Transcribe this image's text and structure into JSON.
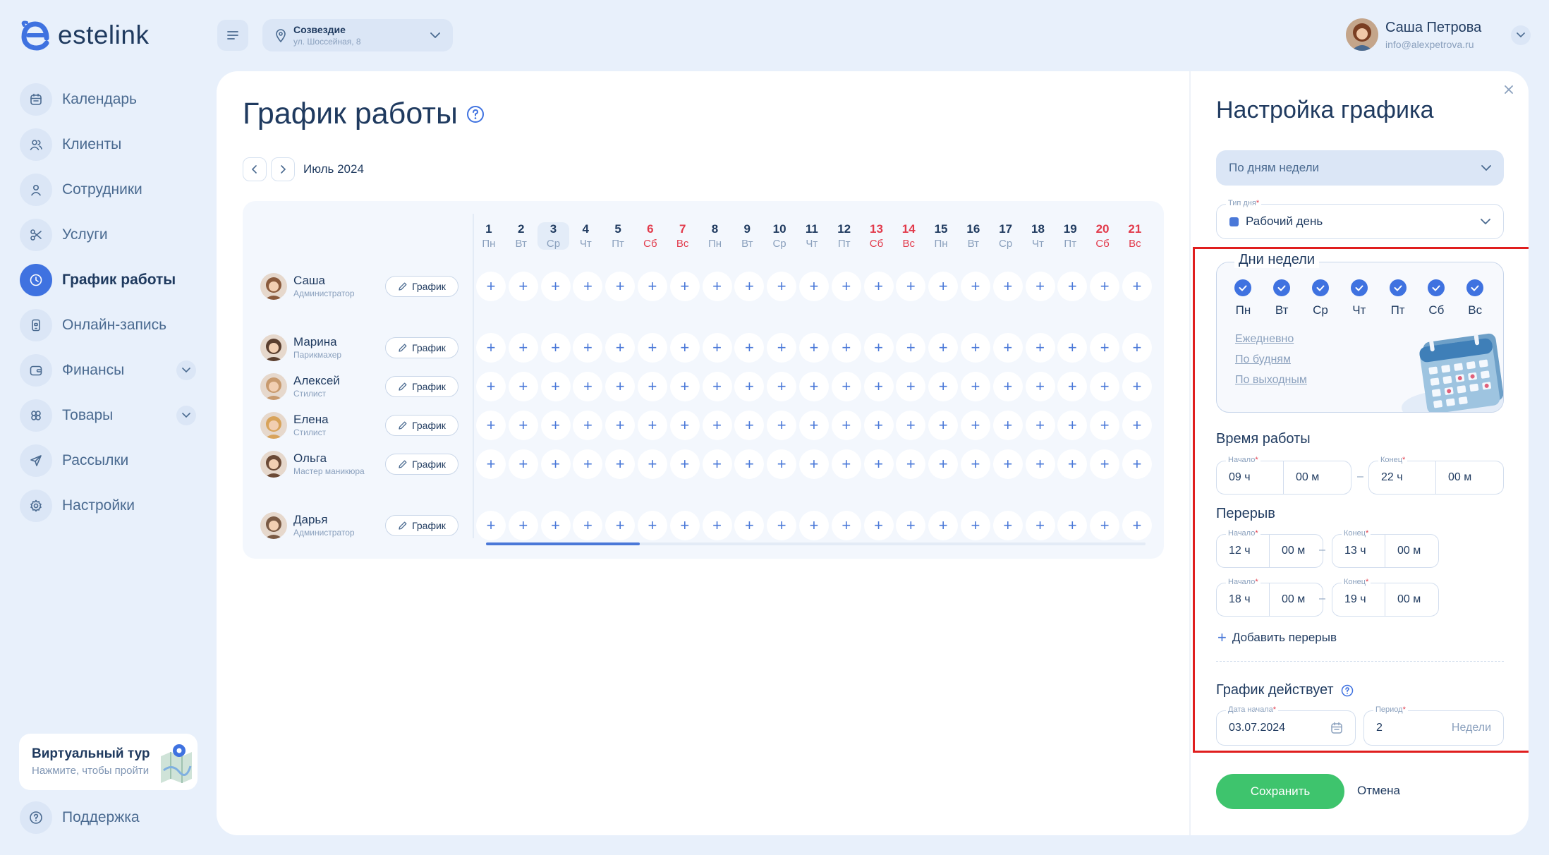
{
  "brand": {
    "name": "estelink"
  },
  "nav": [
    {
      "label": "Календарь",
      "icon": "calendar-icon",
      "active": false,
      "expandable": false
    },
    {
      "label": "Клиенты",
      "icon": "clients-icon",
      "active": false,
      "expandable": false
    },
    {
      "label": "Сотрудники",
      "icon": "staff-icon",
      "active": false,
      "expandable": false
    },
    {
      "label": "Услуги",
      "icon": "scissors-icon",
      "active": false,
      "expandable": false
    },
    {
      "label": "График работы",
      "icon": "clock-icon",
      "active": true,
      "expandable": false
    },
    {
      "label": "Онлайн-запись",
      "icon": "phone-icon",
      "active": false,
      "expandable": false
    },
    {
      "label": "Финансы",
      "icon": "wallet-icon",
      "active": false,
      "expandable": true
    },
    {
      "label": "Товары",
      "icon": "products-icon",
      "active": false,
      "expandable": true
    },
    {
      "label": "Рассылки",
      "icon": "send-icon",
      "active": false,
      "expandable": false
    },
    {
      "label": "Настройки",
      "icon": "gear-icon",
      "active": false,
      "expandable": false
    }
  ],
  "tour": {
    "title": "Виртуальный тур",
    "subtitle": "Нажмите, чтобы пройти"
  },
  "support": {
    "label": "Поддержка"
  },
  "location": {
    "name": "Созвездие",
    "address": "ул. Шоссейная, 8"
  },
  "user": {
    "name": "Саша Петрова",
    "email": "info@alexpetrova.ru"
  },
  "page": {
    "title": "График работы",
    "month": "Июль 2024"
  },
  "days": [
    {
      "n": "1",
      "wd": "Пн",
      "we": false,
      "today": false
    },
    {
      "n": "2",
      "wd": "Вт",
      "we": false,
      "today": false
    },
    {
      "n": "3",
      "wd": "Ср",
      "we": false,
      "today": true
    },
    {
      "n": "4",
      "wd": "Чт",
      "we": false,
      "today": false
    },
    {
      "n": "5",
      "wd": "Пт",
      "we": false,
      "today": false
    },
    {
      "n": "6",
      "wd": "Сб",
      "we": true,
      "today": false
    },
    {
      "n": "7",
      "wd": "Вс",
      "we": true,
      "today": false
    },
    {
      "n": "8",
      "wd": "Пн",
      "we": false,
      "today": false
    },
    {
      "n": "9",
      "wd": "Вт",
      "we": false,
      "today": false
    },
    {
      "n": "10",
      "wd": "Ср",
      "we": false,
      "today": false
    },
    {
      "n": "11",
      "wd": "Чт",
      "we": false,
      "today": false
    },
    {
      "n": "12",
      "wd": "Пт",
      "we": false,
      "today": false
    },
    {
      "n": "13",
      "wd": "Сб",
      "we": true,
      "today": false
    },
    {
      "n": "14",
      "wd": "Вс",
      "we": true,
      "today": false
    },
    {
      "n": "15",
      "wd": "Пн",
      "we": false,
      "today": false
    },
    {
      "n": "16",
      "wd": "Вт",
      "we": false,
      "today": false
    },
    {
      "n": "17",
      "wd": "Ср",
      "we": false,
      "today": false
    },
    {
      "n": "18",
      "wd": "Чт",
      "we": false,
      "today": false
    },
    {
      "n": "19",
      "wd": "Пт",
      "we": false,
      "today": false
    },
    {
      "n": "20",
      "wd": "Сб",
      "we": true,
      "today": false
    },
    {
      "n": "21",
      "wd": "Вс",
      "we": true,
      "today": false
    }
  ],
  "employees": [
    {
      "name": "Саша",
      "role": "Администратор",
      "button": "График",
      "avatar_color": "#8a5a3c"
    },
    {
      "name": "Марина",
      "role": "Парикмахер",
      "button": "График",
      "avatar_color": "#5a3e2e"
    },
    {
      "name": "Алексей",
      "role": "Стилист",
      "button": "График",
      "avatar_color": "#c89a6e"
    },
    {
      "name": "Елена",
      "role": "Стилист",
      "button": "График",
      "avatar_color": "#d8a35a"
    },
    {
      "name": "Ольга",
      "role": "Мастер маникюра",
      "button": "График",
      "avatar_color": "#6b4a36"
    },
    {
      "name": "Дарья",
      "role": "Администратор",
      "button": "График",
      "avatar_color": "#7a5a44"
    }
  ],
  "cell_symbol": "+",
  "panel": {
    "title": "Настройка графика",
    "mode": "По дням недели",
    "day_type_label": "Тип дня",
    "day_type": "Рабочий день",
    "weekdays_legend": "Дни недели",
    "weekdays": [
      "Пн",
      "Вт",
      "Ср",
      "Чт",
      "Пт",
      "Сб",
      "Вс"
    ],
    "quick_links": [
      "Ежедневно",
      "По будням",
      "По выходным"
    ],
    "work_time": {
      "title": "Время работы",
      "start_label": "Начало",
      "end_label": "Конец",
      "start_h": "09 ч",
      "start_m": "00 м",
      "end_h": "22 ч",
      "end_m": "00 м"
    },
    "breaks_title": "Перерыв",
    "breaks": [
      {
        "start_label": "Начало",
        "end_label": "Конец",
        "start_h": "12 ч",
        "start_m": "00 м",
        "end_h": "13 ч",
        "end_m": "00 м"
      },
      {
        "start_label": "Начало",
        "end_label": "Конец",
        "start_h": "18 ч",
        "start_m": "00 м",
        "end_h": "19 ч",
        "end_m": "00 м"
      }
    ],
    "add_break": "Добавить перерыв",
    "valid_title": "График действует",
    "date_label": "Дата начала",
    "date_value": "03.07.2024",
    "period_label": "Период",
    "period_value": "2",
    "period_unit": "Недели",
    "save": "Сохранить",
    "cancel": "Отмена"
  },
  "colors": {
    "accent": "#3f72e0",
    "weekend": "#e23a4b",
    "save": "#3ec46d",
    "highlight_box": "#e01e1e"
  }
}
